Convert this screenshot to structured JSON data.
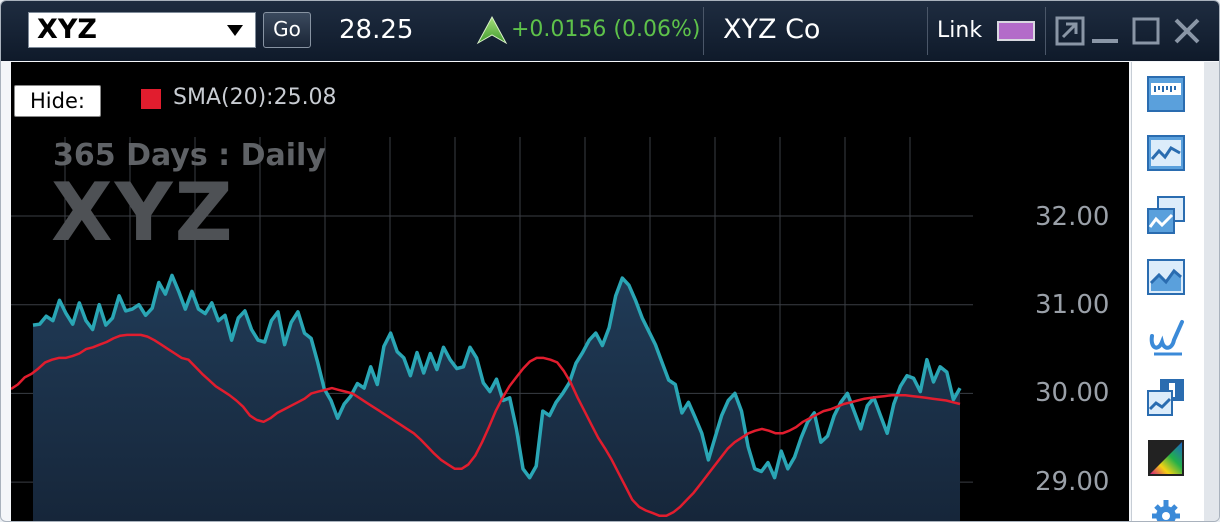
{
  "toolbar": {
    "ticker": "XYZ",
    "go_label": "Go",
    "price": "28.25",
    "change": "+0.0156 (0.06%)",
    "company": "XYZ Co",
    "link_label": "Link",
    "link_color": "#b36bc9"
  },
  "window_controls": [
    "popout-icon",
    "minimize-icon",
    "maximize-icon",
    "close-icon"
  ],
  "legend": {
    "hide_label": "Hide:",
    "sma_label": "SMA(20):25.08",
    "sma_color": "#e11d2e"
  },
  "watermark": {
    "period": "365 Days : Daily",
    "symbol": "XYZ"
  },
  "tools": [
    "ruler-icon",
    "line-chart-icon",
    "compare-chart-icon",
    "area-chart-icon",
    "draw-icon",
    "indicator-icon",
    "color-palette-icon",
    "gear-icon"
  ],
  "colors": {
    "price_line": "#2aa6b5",
    "sma_line": "#e11d2e",
    "up_change": "#5ec24a",
    "background": "#000000"
  },
  "chart_data": {
    "type": "area",
    "y_ticks": [
      "32.00",
      "31.00",
      "30.00",
      "29.00"
    ],
    "ylim": [
      28.6,
      33.0
    ],
    "x_count": 140,
    "series": [
      {
        "name": "",
        "values": [
          30.77,
          30.78,
          30.87,
          30.82,
          31.05,
          30.9,
          30.78,
          31.02,
          30.82,
          30.72,
          31.0,
          30.77,
          30.85,
          31.1,
          30.93,
          30.95,
          31.0,
          30.88,
          30.96,
          31.25,
          31.12,
          31.33,
          31.15,
          30.95,
          31.15,
          30.95,
          30.9,
          31.02,
          30.82,
          30.88,
          30.6,
          30.85,
          30.93,
          30.72,
          30.6,
          30.58,
          30.82,
          30.92,
          30.55,
          30.8,
          30.92,
          30.68,
          30.62,
          30.35,
          30.05,
          29.92,
          29.72,
          29.88,
          29.97,
          30.11,
          30.06,
          30.3,
          30.1,
          30.53,
          30.68,
          30.47,
          30.4,
          30.2,
          30.46,
          30.23,
          30.45,
          30.27,
          30.52,
          30.38,
          30.28,
          30.3,
          30.52,
          30.4,
          30.12,
          30.02,
          30.16,
          29.92,
          29.95,
          29.6,
          29.15,
          29.05,
          29.18,
          29.8,
          29.75,
          29.9,
          30.0,
          30.12,
          30.34,
          30.46,
          30.6,
          30.68,
          30.54,
          30.74,
          31.1,
          31.3,
          31.22,
          31.05,
          30.85,
          30.7,
          30.55,
          30.35,
          30.15,
          30.1,
          29.78,
          29.9,
          29.73,
          29.55,
          29.25,
          29.5,
          29.75,
          29.92,
          30.0,
          29.8,
          29.4,
          29.15,
          29.12,
          29.22,
          29.05,
          29.35,
          29.15,
          29.28,
          29.5,
          29.68,
          29.78,
          29.45,
          29.52,
          29.75,
          29.9,
          30.0,
          29.8,
          29.6,
          29.86,
          29.95,
          29.75,
          29.55,
          29.88,
          30.08,
          30.2,
          30.17,
          30.02,
          30.38,
          30.13,
          30.3,
          30.24,
          29.93,
          30.06
        ]
      },
      {
        "name": "",
        "values": [
          30.05,
          30.1,
          30.18,
          30.22,
          30.28,
          30.35,
          30.38,
          30.4,
          30.4,
          30.42,
          30.45,
          30.5,
          30.52,
          30.55,
          30.58,
          30.62,
          30.65,
          30.66,
          30.66,
          30.66,
          30.64,
          30.6,
          30.55,
          30.5,
          30.45,
          30.4,
          30.38,
          30.3,
          30.22,
          30.15,
          30.08,
          30.03,
          29.98,
          29.92,
          29.85,
          29.75,
          29.7,
          29.68,
          29.72,
          29.78,
          29.82,
          29.86,
          29.9,
          29.94,
          30.0,
          30.02,
          30.04,
          30.06,
          30.04,
          30.02,
          30.0,
          29.95,
          29.9,
          29.85,
          29.8,
          29.75,
          29.7,
          29.65,
          29.6,
          29.55,
          29.48,
          29.4,
          29.32,
          29.25,
          29.2,
          29.15,
          29.15,
          29.2,
          29.3,
          29.45,
          29.62,
          29.8,
          29.95,
          30.08,
          30.18,
          30.28,
          30.36,
          30.4,
          30.4,
          30.38,
          30.35,
          30.25,
          30.12,
          29.95,
          29.8,
          29.65,
          29.5,
          29.38,
          29.25,
          29.1,
          28.95,
          28.8,
          28.72,
          28.68,
          28.65,
          28.62,
          28.62,
          28.66,
          28.72,
          28.8,
          28.88,
          28.98,
          29.08,
          29.18,
          29.28,
          29.38,
          29.45,
          29.5,
          29.55,
          29.58,
          29.6,
          29.58,
          29.55,
          29.55,
          29.58,
          29.62,
          29.68,
          29.72,
          29.76,
          29.8,
          29.82,
          29.85,
          29.88,
          29.9,
          29.92,
          29.94,
          29.95,
          29.96,
          29.97,
          29.98,
          29.98,
          29.98,
          29.97,
          29.96,
          29.95,
          29.94,
          29.93,
          29.92,
          29.9,
          29.88
        ]
      }
    ]
  }
}
